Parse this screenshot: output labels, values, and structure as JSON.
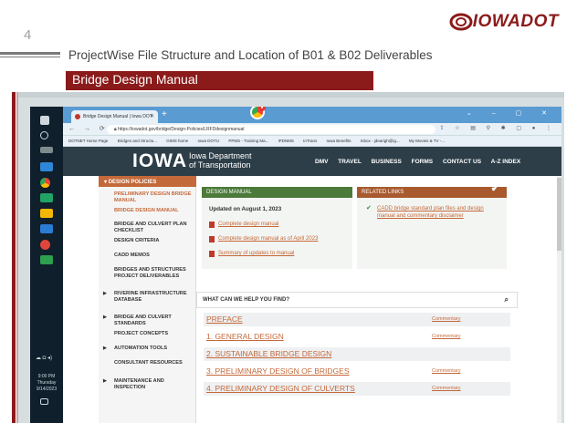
{
  "slide": {
    "number": "4",
    "logo_text": "IOWADOT",
    "title": "ProjectWise File Structure and Location of B01 & B02 Deliverables",
    "subtitle": "Bridge Design Manual"
  },
  "taskbar": {
    "clock_time": "9:00 PM",
    "clock_day": "Thursday",
    "clock_date": "9/14/2023"
  },
  "browser": {
    "tab_title": "Bridge Design Manual | Iowa DOT",
    "url": "https://iowadot.gov/bridge/Design-Policies/LRFDdesignmanual",
    "bookmarks": [
      "DOTNET Home Page",
      "Bridges and Structu...",
      "GIMS home",
      "Iowa DOTU",
      "PPMS - Training Ma...",
      "iPDNMS",
      "InTrans",
      "Iowa Benefits",
      "Inbox - jdearigh@ig...",
      "My Movies & TV -..."
    ]
  },
  "site": {
    "logo": "IOWA",
    "dept_line1": "Iowa Department",
    "dept_line2": "of Transportation",
    "nav": [
      "DMV",
      "TRAVEL",
      "BUSINESS",
      "FORMS",
      "CONTACT US",
      "A-Z INDEX"
    ]
  },
  "leftnav": {
    "header": "DESIGN POLICIES",
    "items": [
      "PRELIMINARY DESIGN BRIDGE MANUAL",
      "BRIDGE DESIGN MANUAL",
      "BRIDGE AND CULVERT PLAN CHECKLIST",
      "DESIGN CRITERIA",
      "CADD MEMOS",
      "BRIDGES AND STRUCTURES PROJECT DELIVERABLES",
      "RIVERINE INFRASTRUCTURE DATABASE",
      "BRIDGE AND CULVERT STANDARDS",
      "PROJECT CONCEPTS",
      "AUTOMATION TOOLS",
      "CONSULTANT RESOURCES",
      "MAINTENANCE AND INSPECTION"
    ]
  },
  "design_manual": {
    "header": "DESIGN MANUAL",
    "updated": "Updated on August 1, 2023",
    "links": [
      "Complete design manual",
      "Complete design manual as of April 2023",
      "Summary of updates to manual"
    ]
  },
  "related_links": {
    "header": "RELATED LINKS",
    "link": "CADD bridge standard plan files and design manual and commentary disclaimer"
  },
  "search": {
    "label": "WHAT CAN WE HELP YOU FIND?"
  },
  "chapters": [
    {
      "title": "PREFACE",
      "commentary": "Commentary"
    },
    {
      "title": "1. GENERAL DESIGN",
      "commentary": "Commentary"
    },
    {
      "title": "2. SUSTAINABLE BRIDGE DESIGN",
      "commentary": ""
    },
    {
      "title": "3. PRELIMINARY DESIGN OF BRIDGES",
      "commentary": "Commentary"
    },
    {
      "title": "4. PRELIMINARY DESIGN OF CULVERTS",
      "commentary": "Commentary"
    }
  ],
  "colors": {
    "brand_red": "#8b1a1a",
    "orange": "#c4693a",
    "green": "#4b7a3a",
    "header_dark": "#2d3e48"
  }
}
